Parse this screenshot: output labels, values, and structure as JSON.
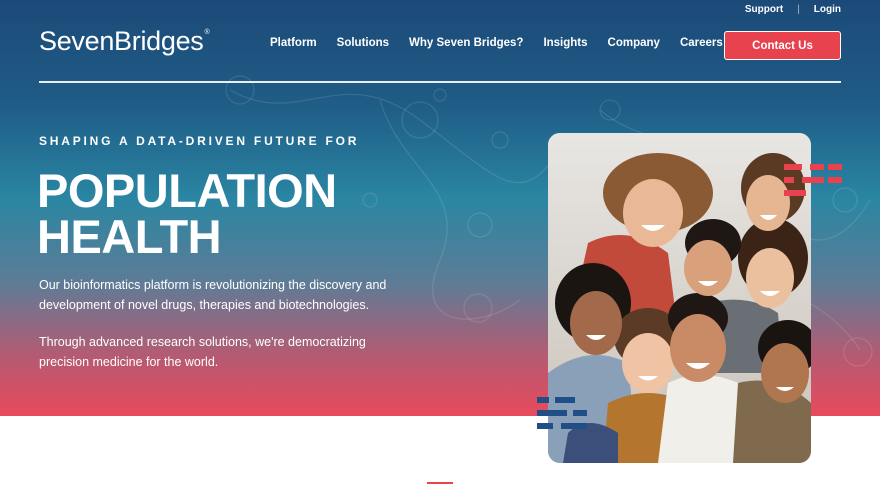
{
  "brand": {
    "logo_text": "SevenBridges",
    "registered_mark": "®"
  },
  "utility_nav": {
    "support": "Support",
    "separator": "|",
    "login": "Login"
  },
  "nav": {
    "items": [
      {
        "label": "Platform"
      },
      {
        "label": "Solutions"
      },
      {
        "label": "Why Seven Bridges?"
      },
      {
        "label": "Insights"
      },
      {
        "label": "Company"
      },
      {
        "label": "Careers"
      }
    ],
    "cta": "Contact Us"
  },
  "hero": {
    "eyebrow": "SHAPING A DATA-DRIVEN FUTURE FOR",
    "headline_line1": "POPULATION",
    "headline_line2": "HEALTH",
    "paragraph1": "Our bioinformatics platform is revolutionizing the discovery and development of novel drugs, therapies and biotechnologies.",
    "paragraph2": "Through advanced research solutions, we're democratizing precision medicine for the world."
  },
  "colors": {
    "accent_red": "#e8424f",
    "navy": "#1c4a78",
    "teal": "#2a86a3",
    "decor_blue": "#1f4f86"
  },
  "icons": {
    "photo": "group-of-friends-photo",
    "decor_red": "red-stripe-bars-icon",
    "decor_blue": "blue-stripe-bars-icon"
  }
}
